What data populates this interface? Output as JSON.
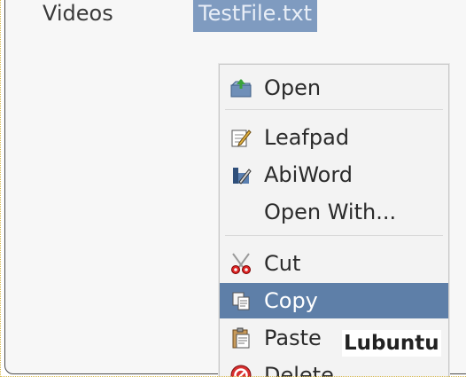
{
  "sidebar": {
    "visible_item": "Videos"
  },
  "file_view": {
    "selected_file": "TestFile.txt"
  },
  "context_menu": {
    "items": [
      {
        "label": "Open",
        "icon": "folder-open-icon"
      },
      {
        "label": "Leafpad",
        "icon": "leafpad-icon"
      },
      {
        "label": "AbiWord",
        "icon": "abiword-icon"
      },
      {
        "label": "Open With...",
        "icon": ""
      },
      {
        "label": "Cut",
        "icon": "scissors-icon"
      },
      {
        "label": "Copy",
        "icon": "copy-icon",
        "highlighted": true
      },
      {
        "label": "Paste",
        "icon": "paste-icon"
      },
      {
        "label": "Delete",
        "icon": "delete-icon"
      }
    ]
  },
  "caption": "Lubuntu",
  "colors": {
    "highlight": "#5e7fa8",
    "selection": "#7f9bc0",
    "frame_dots": "#d8b84a"
  }
}
